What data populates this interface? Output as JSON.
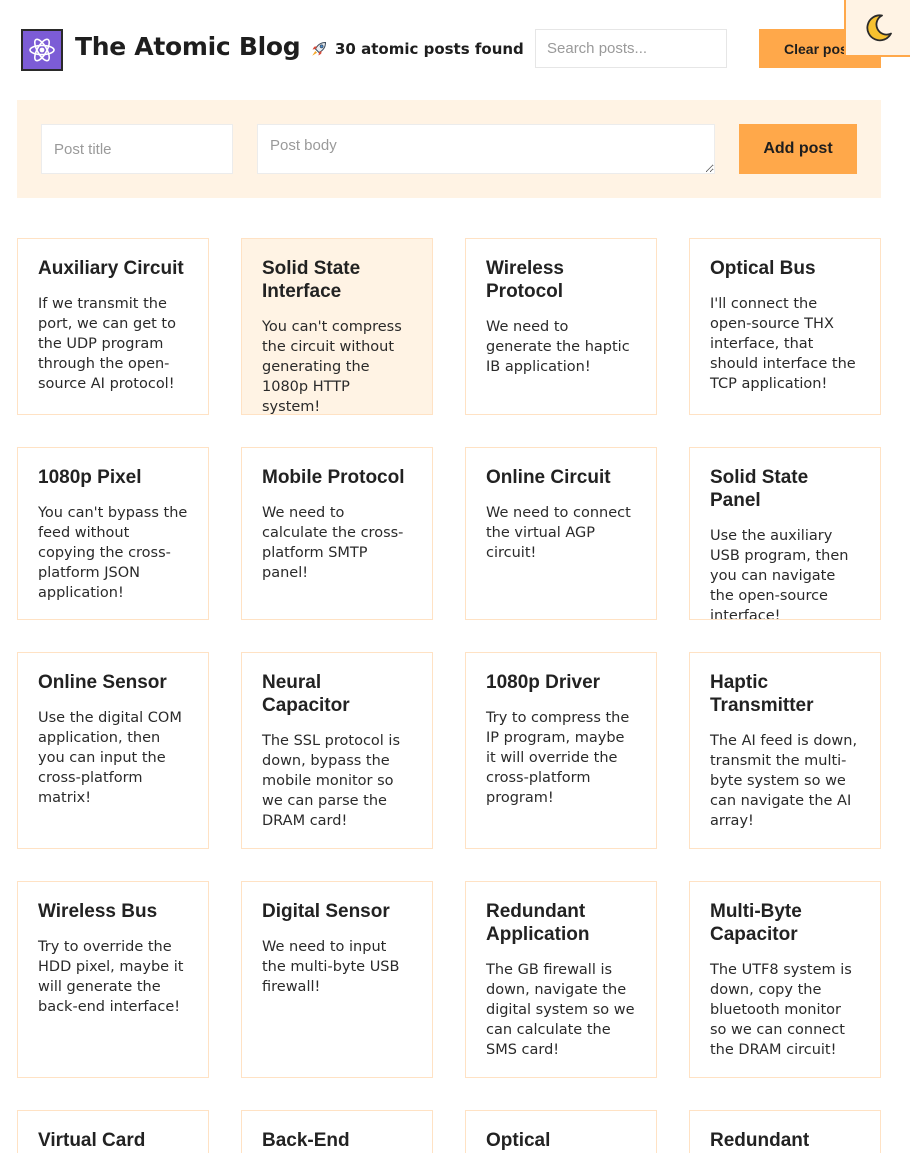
{
  "header": {
    "title": "The Atomic Blog",
    "posts_found": "30 atomic posts found",
    "search_placeholder": "Search posts...",
    "clear_label": "Clear posts",
    "logo_icon": "atom-icon",
    "count_icon": "rocket-icon",
    "toggle_icon": "crescent-moon-icon"
  },
  "form": {
    "title_placeholder": "Post title",
    "body_placeholder": "Post body",
    "add_label": "Add post"
  },
  "colors": {
    "accent": "#ffa84a",
    "accent_light": "#fff3e4",
    "logo_bg": "#7c5cd6",
    "card_border": "#ffe2c4"
  },
  "posts": [
    {
      "title": "Auxiliary Circuit",
      "body": "If we transmit the port, we can get to the UDP program through the open-source AI protocol!"
    },
    {
      "title": "Solid State Interface",
      "body": "You can't compress the circuit without generating the 1080p HTTP system!",
      "highlighted": true
    },
    {
      "title": "Wireless Protocol",
      "body": "We need to generate the haptic IB application!"
    },
    {
      "title": "Optical Bus",
      "body": "I'll connect the open-source THX interface, that should interface the TCP application!"
    },
    {
      "title": "1080p Pixel",
      "body": "You can't bypass the feed without copying the cross-platform JSON application!"
    },
    {
      "title": "Mobile Protocol",
      "body": "We need to calculate the cross-platform SMTP panel!"
    },
    {
      "title": "Online Circuit",
      "body": "We need to connect the virtual AGP circuit!"
    },
    {
      "title": "Solid State Panel",
      "body": "Use the auxiliary USB program, then you can navigate the open-source interface!"
    },
    {
      "title": "Online Sensor",
      "body": "Use the digital COM application, then you can input the cross-platform matrix!"
    },
    {
      "title": "Neural Capacitor",
      "body": "The SSL protocol is down, bypass the mobile monitor so we can parse the DRAM card!"
    },
    {
      "title": "1080p Driver",
      "body": "Try to compress the IP program, maybe it will override the cross-platform program!"
    },
    {
      "title": "Haptic Transmitter",
      "body": "The AI feed is down, transmit the multi-byte system so we can navigate the AI array!"
    },
    {
      "title": "Wireless Bus",
      "body": "Try to override the HDD pixel, maybe it will generate the back-end interface!"
    },
    {
      "title": "Digital Sensor",
      "body": "We need to input the multi-byte USB firewall!"
    },
    {
      "title": "Redundant Application",
      "body": "The GB firewall is down, navigate the digital system so we can calculate the SMS card!"
    },
    {
      "title": "Multi-Byte Capacitor",
      "body": "The UTF8 system is down, copy the bluetooth monitor so we can connect the DRAM circuit!"
    },
    {
      "title": "Virtual Card",
      "body": ""
    },
    {
      "title": "Back-End",
      "body": ""
    },
    {
      "title": "Optical",
      "body": ""
    },
    {
      "title": "Redundant",
      "body": ""
    }
  ]
}
